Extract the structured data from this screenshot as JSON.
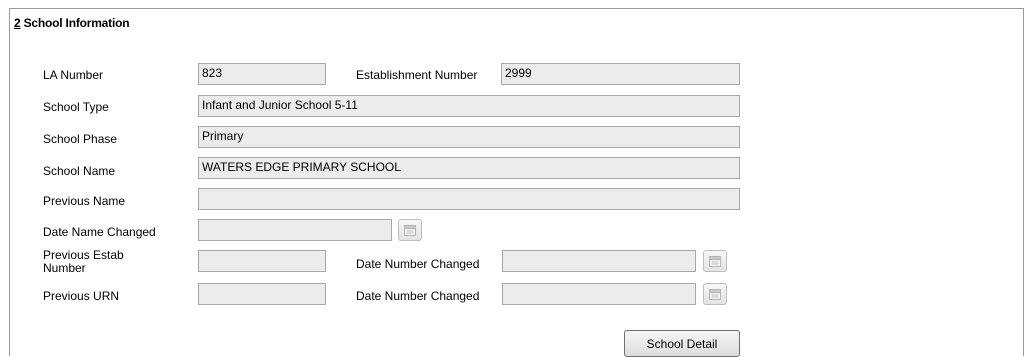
{
  "section": {
    "number": "2",
    "title": " School Information"
  },
  "fields": {
    "la_number": {
      "label": "LA Number",
      "value": "823"
    },
    "establishment_number": {
      "label": "Establishment Number",
      "value": "2999"
    },
    "school_type": {
      "label": "School Type",
      "value": "Infant and Junior School 5-11"
    },
    "school_phase": {
      "label": "School Phase",
      "value": "Primary"
    },
    "school_name": {
      "label": "School Name",
      "value": "WATERS EDGE PRIMARY SCHOOL"
    },
    "previous_name": {
      "label": "Previous Name",
      "value": ""
    },
    "date_name_changed": {
      "label": "Date Name Changed",
      "value": ""
    },
    "previous_estab_number": {
      "label_line1": "Previous Estab",
      "label_line2": "Number",
      "value": ""
    },
    "date_number_changed_1": {
      "label": "Date Number Changed",
      "value": ""
    },
    "previous_urn": {
      "label": "Previous URN",
      "value": ""
    },
    "date_number_changed_2": {
      "label": "Date Number Changed",
      "value": ""
    }
  },
  "buttons": {
    "school_detail": "School Detail"
  },
  "icons": {
    "calendar": "calendar-icon"
  }
}
